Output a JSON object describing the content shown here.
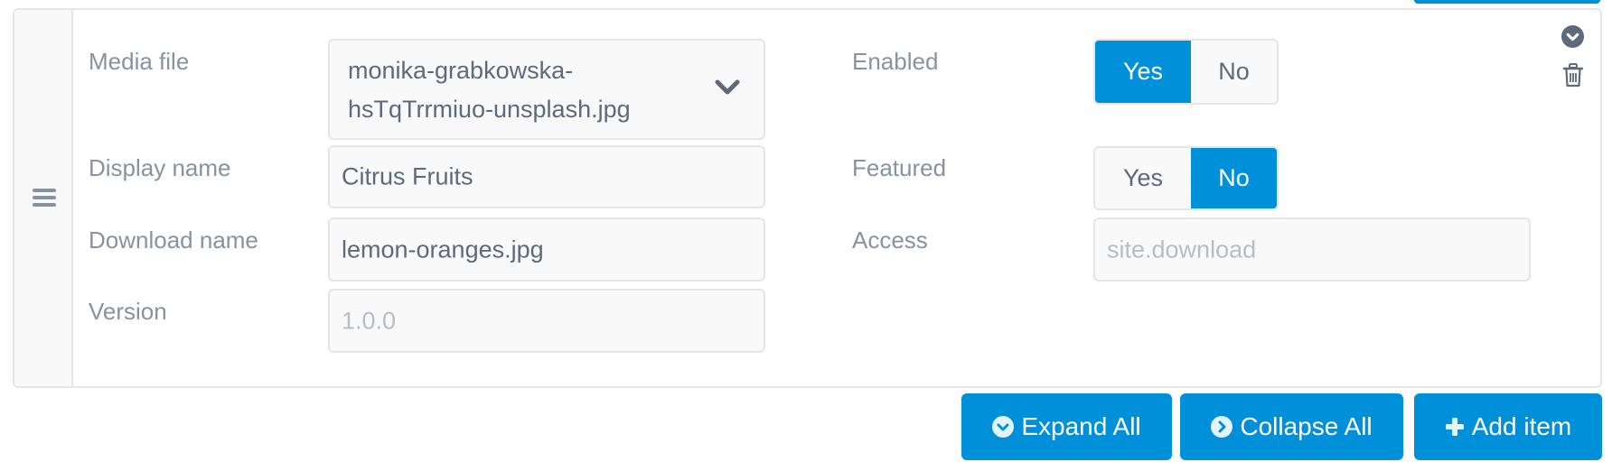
{
  "repeatable_item": {
    "fields_left": [
      {
        "label": "Media file",
        "value": "monika-grabkowska-hsTqTrrmiuo-unsplash.jpg",
        "type": "select"
      },
      {
        "label": "Display name",
        "value": "Citrus Fruits",
        "type": "text"
      },
      {
        "label": "Download name",
        "value": "lemon-oranges.jpg",
        "type": "text"
      },
      {
        "label": "Version",
        "value": "",
        "placeholder": "1.0.0",
        "type": "text"
      }
    ],
    "fields_right": [
      {
        "label": "Enabled",
        "type": "toggle",
        "options": [
          "Yes",
          "No"
        ],
        "selected": "Yes"
      },
      {
        "label": "Featured",
        "type": "toggle",
        "options": [
          "Yes",
          "No"
        ],
        "selected": "No"
      },
      {
        "label": "Access",
        "type": "text",
        "value": "",
        "placeholder": "site.download"
      }
    ],
    "icons": {
      "drag_handle": "bars-icon",
      "collapse_item": "chevron-circle-down-icon",
      "delete_item": "trash-icon"
    }
  },
  "actions": {
    "expand_all": "Expand All",
    "collapse_all": "Collapse All",
    "add_item": "Add item"
  },
  "colors": {
    "primary": "#0090d9",
    "border": "#e5e6e8",
    "label": "#8792a2",
    "text": "#5c6a7c",
    "placeholder": "#b7bdc6",
    "icon": "#5c6a7c"
  }
}
